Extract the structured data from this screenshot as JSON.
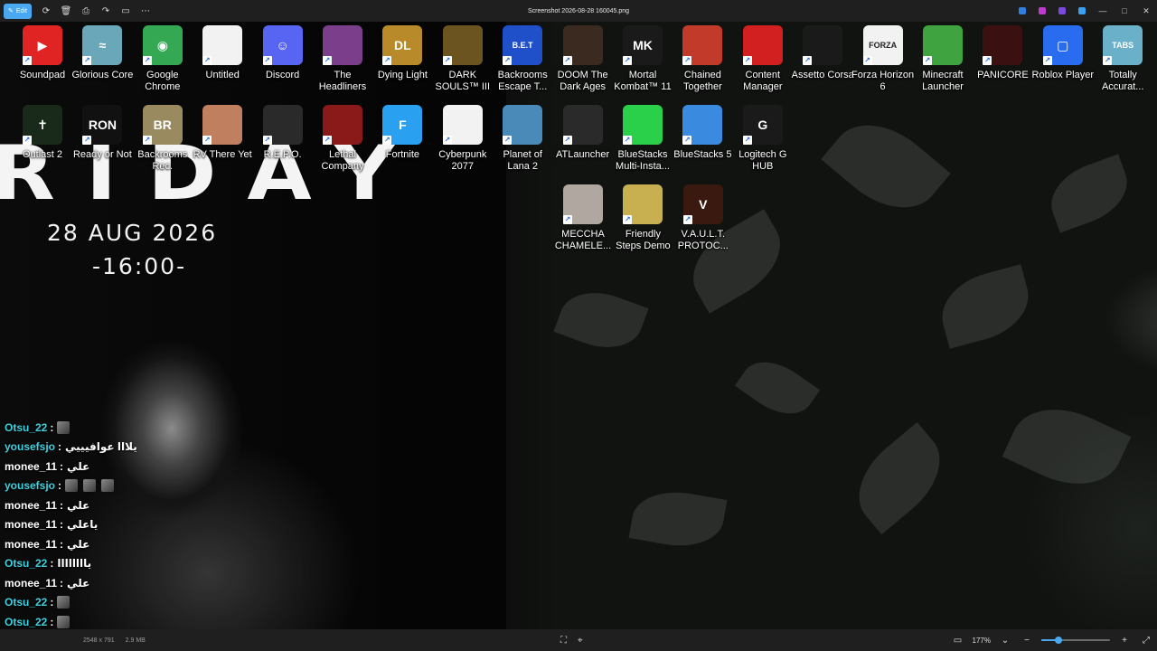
{
  "titlebar": {
    "edit_label": "Edit",
    "file_name": "Screenshot 2026-08-28 160045.png",
    "tools": [
      "rotate-icon",
      "delete-icon",
      "print-icon",
      "share-icon",
      "slideshow-icon",
      "more-icon"
    ],
    "accent": "#4aa8f0"
  },
  "wallpaper": {
    "headline": "RIDAY",
    "date": "28 AUG 2026",
    "time": "-16:00-"
  },
  "desktop": {
    "row1": [
      {
        "label": "Soundpad",
        "icon": "soundpad-icon",
        "color": "#e02424",
        "glyph": "▶"
      },
      {
        "label": "Glorious Core",
        "icon": "glorious-core-icon",
        "color": "#6aa7b8",
        "glyph": "≈"
      },
      {
        "label": "Google Chrome",
        "icon": "chrome-icon",
        "color": "#34a853",
        "glyph": "◉"
      },
      {
        "label": "Untitled",
        "icon": "document-icon",
        "color": "#f2f2f2",
        "glyph": ""
      },
      {
        "label": "Discord",
        "icon": "discord-icon",
        "color": "#5865f2",
        "glyph": "☺"
      },
      {
        "label": "The Headliners",
        "icon": "headliners-icon",
        "color": "#7a3e8a",
        "glyph": ""
      },
      {
        "label": "Dying Light",
        "icon": "dying-light-icon",
        "color": "#b88a2a",
        "glyph": "DL"
      },
      {
        "label": "DARK SOULS™ III",
        "icon": "dark-souls-icon",
        "color": "#6b5420",
        "glyph": ""
      },
      {
        "label": "Backrooms Escape T...",
        "icon": "backrooms-escape-icon",
        "color": "#1f4fc9",
        "glyph": "B.E.T"
      },
      {
        "label": "DOOM The Dark Ages",
        "icon": "doom-icon",
        "color": "#3a2a20",
        "glyph": ""
      },
      {
        "label": "Mortal Kombat™ 11",
        "icon": "mortal-kombat-icon",
        "color": "#1a1a1a",
        "glyph": "MK"
      },
      {
        "label": "Chained Together",
        "icon": "chained-together-icon",
        "color": "#c23a2a",
        "glyph": ""
      },
      {
        "label": "Content Manager",
        "icon": "content-manager-icon",
        "color": "#d21f1f",
        "glyph": ""
      },
      {
        "label": "Assetto Corsa",
        "icon": "assetto-corsa-icon",
        "color": "#1a1a1a",
        "glyph": ""
      },
      {
        "label": "Forza Horizon 6",
        "icon": "forza-icon",
        "color": "#f2f2f2",
        "glyph": "FORZA"
      },
      {
        "label": "Minecraft Launcher",
        "icon": "minecraft-icon",
        "color": "#3fa43f",
        "glyph": ""
      },
      {
        "label": "PANICORE",
        "icon": "panicore-icon",
        "color": "#3a1010",
        "glyph": ""
      },
      {
        "label": "Roblox Player",
        "icon": "roblox-icon",
        "color": "#2a6cf0",
        "glyph": "▢"
      },
      {
        "label": "Totally Accurat...",
        "icon": "tabs-icon",
        "color": "#6ab0c8",
        "glyph": "TABS"
      }
    ],
    "row2": [
      {
        "label": "Outlast 2",
        "icon": "outlast-icon",
        "color": "#1a2a1a",
        "glyph": "✝"
      },
      {
        "label": "Ready or Not",
        "icon": "ready-or-not-icon",
        "color": "#111111",
        "glyph": "RON"
      },
      {
        "label": "Backrooms Rec.",
        "icon": "backrooms-rec-icon",
        "color": "#9a8a60",
        "glyph": "BR"
      },
      {
        "label": "RV There Yet",
        "icon": "rv-there-yet-icon",
        "color": "#c08060",
        "glyph": ""
      },
      {
        "label": "R.E.P.O.",
        "icon": "repo-icon",
        "color": "#2a2a2a",
        "glyph": ""
      },
      {
        "label": "Lethal Company",
        "icon": "lethal-company-icon",
        "color": "#8a1a1a",
        "glyph": ""
      },
      {
        "label": "Fortnite",
        "icon": "fortnite-icon",
        "color": "#2aa0f0",
        "glyph": "F"
      },
      {
        "label": "Cyberpunk 2077",
        "icon": "cyberpunk-icon",
        "color": "#f2f2f2",
        "glyph": ""
      },
      {
        "label": "Planet of Lana 2",
        "icon": "planet-of-lana-icon",
        "color": "#4a8ab8",
        "glyph": ""
      },
      {
        "label": "ATLauncher",
        "icon": "atlauncher-icon",
        "color": "#2a2a2a",
        "glyph": ""
      },
      {
        "label": "BlueStacks Multi-Insta...",
        "icon": "bluestacks-multi-icon",
        "color": "#2ad04a",
        "glyph": ""
      },
      {
        "label": "BlueStacks 5",
        "icon": "bluestacks-icon",
        "color": "#3a8ae0",
        "glyph": ""
      },
      {
        "label": "Logitech G HUB",
        "icon": "logitech-ghub-icon",
        "color": "#1a1a1a",
        "glyph": "G"
      }
    ],
    "row3": [
      {
        "label": "MECCHA CHAMELE...",
        "icon": "meccha-chameleon-icon",
        "color": "#b0a8a0",
        "glyph": ""
      },
      {
        "label": "Friendly Steps Demo",
        "icon": "friendly-steps-icon",
        "color": "#c8b050",
        "glyph": ""
      },
      {
        "label": "V.A.U.L.T. PROTOC...",
        "icon": "vault-protocol-icon",
        "color": "#3a1a10",
        "glyph": "V"
      }
    ]
  },
  "chat": [
    {
      "user": "Otsu_22",
      "color": "#3fd0e0",
      "msg": "",
      "emotes": 1
    },
    {
      "user": "yousefsjo",
      "color": "#3fd0e0",
      "msg": "يلااا عوافيييي",
      "emotes": 0
    },
    {
      "user": "monee_11",
      "color": "#ffffff",
      "msg": "علي",
      "emotes": 0
    },
    {
      "user": "yousefsjo",
      "color": "#3fd0e0",
      "msg": "",
      "emotes": 3
    },
    {
      "user": "monee_11",
      "color": "#ffffff",
      "msg": "علي",
      "emotes": 0
    },
    {
      "user": "monee_11",
      "color": "#ffffff",
      "msg": "ياعلي",
      "emotes": 0
    },
    {
      "user": "monee_11",
      "color": "#ffffff",
      "msg": "علي",
      "emotes": 0
    },
    {
      "user": "Otsu_22",
      "color": "#3fd0e0",
      "msg": "ياااااااا",
      "emotes": 0
    },
    {
      "user": "monee_11",
      "color": "#ffffff",
      "msg": "علي",
      "emotes": 0
    },
    {
      "user": "Otsu_22",
      "color": "#3fd0e0",
      "msg": "",
      "emotes": 1
    },
    {
      "user": "Otsu_22",
      "color": "#3fd0e0",
      "msg": "",
      "emotes": 1
    },
    {
      "user": "Otsu_22",
      "color": "#3fd0e0",
      "msg": "",
      "emotes": 1
    }
  ],
  "statusbar": {
    "dimensions": "2548 x 791",
    "file_size": "2.9 MB",
    "zoom": "177%",
    "zoom_fraction": 0.25
  }
}
